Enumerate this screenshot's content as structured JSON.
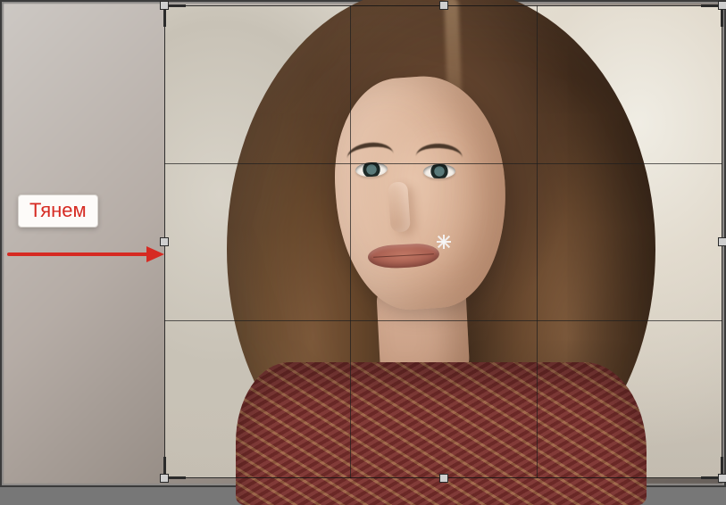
{
  "annotation": {
    "label": "Тянем",
    "color": "#d62a22"
  },
  "crop": {
    "grid": "rule-of-thirds",
    "handles": [
      "top-left",
      "top",
      "top-right",
      "left",
      "right",
      "bottom-left",
      "bottom",
      "bottom-right"
    ],
    "active_handle": "left"
  },
  "icons": {
    "center_target": "move-target-icon",
    "arrow": "arrow-right-icon"
  }
}
